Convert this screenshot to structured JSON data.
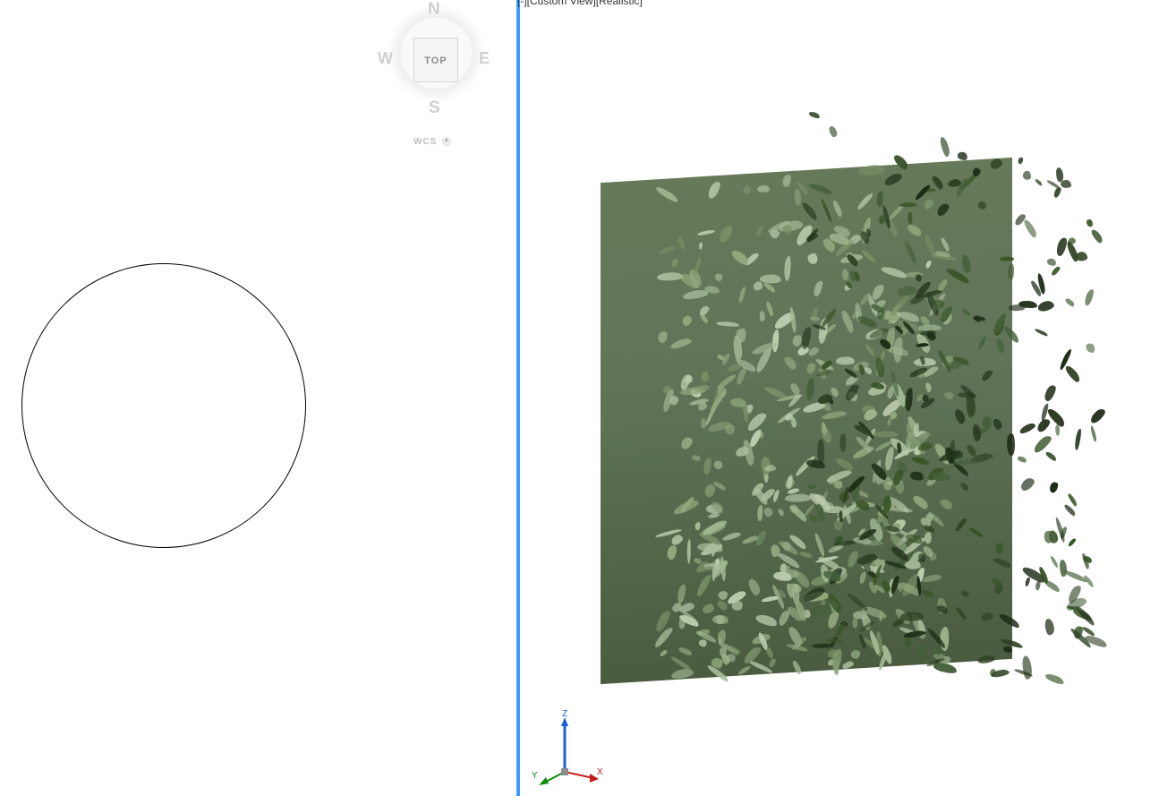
{
  "left_viewport": {
    "viewcube": {
      "face_label": "TOP",
      "north": "N",
      "south": "S",
      "east": "E",
      "west": "W",
      "wcs_label": "WCS"
    }
  },
  "right_viewport": {
    "label_bracketed": "[-][Custom View][Realistic]",
    "axis": {
      "x": "X",
      "y": "Y",
      "z": "Z"
    }
  }
}
